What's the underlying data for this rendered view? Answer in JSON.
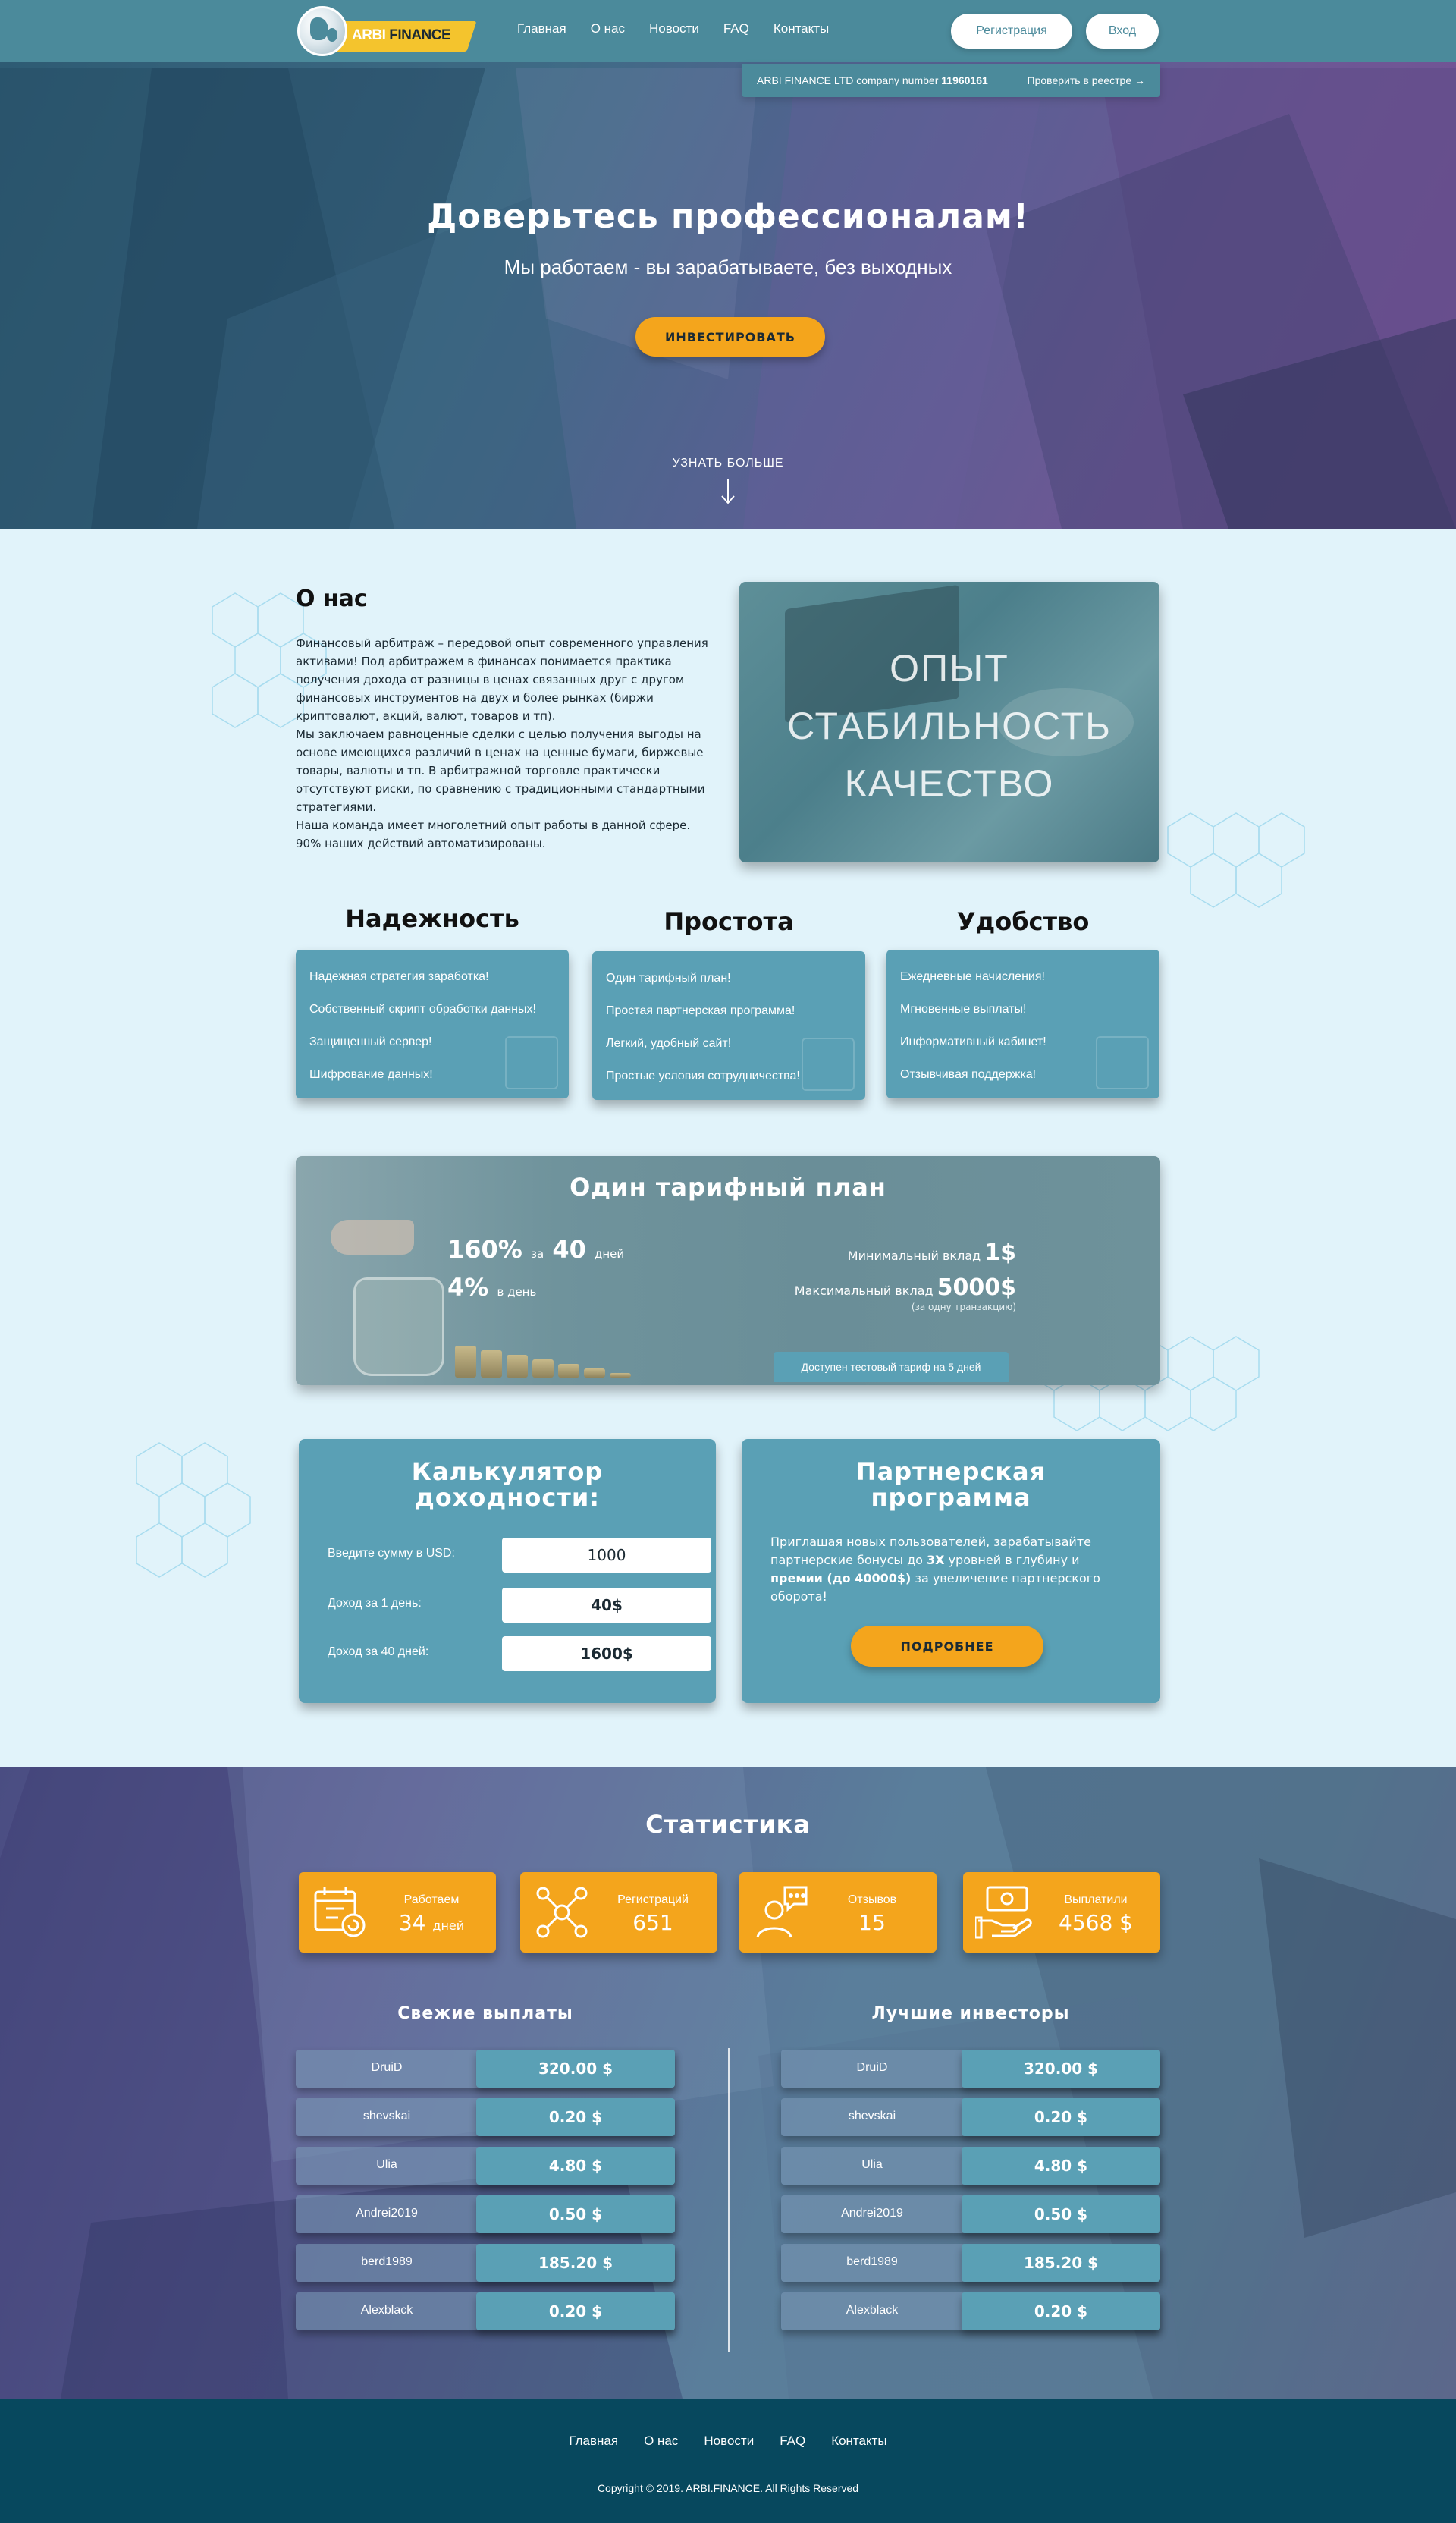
{
  "header": {
    "logo_part1": "ARBI",
    "logo_part2": "FINANCE",
    "nav": [
      "Главная",
      "О нас",
      "Новости",
      "FAQ",
      "Контакты"
    ],
    "register_label": "Регистрация",
    "login_label": "Вход"
  },
  "registry": {
    "company_text": "ARBI FINANCE LTD company number",
    "company_number": "11960161",
    "check_link": "Проверить в реестре →"
  },
  "hero": {
    "title": "Доверьтесь профессионалам!",
    "subtitle": "Мы работаем - вы зарабатываете, без выходных",
    "invest_label": "ИНВЕСТИРОВАТЬ",
    "learn_more": "УЗНАТЬ БОЛЬШЕ"
  },
  "about": {
    "title": "О нас",
    "paragraphs": [
      "Финансовый арбитраж – передовой опыт современного управления активами! Под арбитражем в финансах понимается практика получения дохода от разницы в ценах связанных друг с другом финансовых инструментов на двух и более рынках (биржи криптовалют, акций, валют, товаров и тп).",
      "Мы заключаем равноценные сделки с целью получения выгоды на основе имеющихся различий в ценах на ценные бумаги, биржевые товары, валюты и тп. В арбитражной торговле практически отсутствуют риски, по сравнению с традиционными стандартными стратегиями.",
      "Наша команда имеет многолетний опыт работы в данной сфере. 90% наших действий автоматизированы."
    ],
    "photo_words": [
      "ОПЫТ",
      "СТАБИЛЬНОСТЬ",
      "КАЧЕСТВО"
    ]
  },
  "features": [
    {
      "title": "Надежность",
      "items": [
        "Надежная стратегия заработка!",
        "Собственный скрипт обработки данных!",
        "Защищенный сервер!",
        "Шифрование данных!"
      ]
    },
    {
      "title": "Простота",
      "items": [
        "Один тарифный план!",
        "Простая партнерская программа!",
        "Легкий, удобный сайт!",
        "Простые условия сотрудничества!"
      ]
    },
    {
      "title": "Удобство",
      "items": [
        "Ежедневные начисления!",
        "Мгновенные выплаты!",
        "Информативный кабинет!",
        "Отзывчивая поддержка!"
      ]
    }
  ],
  "tariff": {
    "title": "Один тарифный план",
    "profit_pct": "160%",
    "profit_for": "за",
    "profit_days": "40",
    "profit_days_label": "дней",
    "daily_pct": "4%",
    "daily_label": "в день",
    "min_label": "Минимальный вклад",
    "min_value": "1$",
    "max_label": "Максимальный вклад",
    "max_value": "5000$",
    "max_note": "(за одну транзакцию)",
    "test_label": "Доступен тестовый тариф на 5 дней"
  },
  "calculator": {
    "title_line1": "Калькулятор",
    "title_line2": "доходности:",
    "amount_label": "Введите сумму в USD:",
    "amount_value": "1000",
    "day_label": "Доход за 1 день:",
    "day_value": "40$",
    "total_label": "Доход за 40 дней:",
    "total_value": "1600$"
  },
  "partner": {
    "title_line1": "Партнерская",
    "title_line2": "программа",
    "text_a": "Приглашая новых пользователей, зарабатывайте партнерские бонусы до ",
    "text_b": "3Х",
    "text_c": " уровней в глубину и ",
    "text_d": "премии (до 40000$)",
    "text_e": " за увеличение партнерского оборота!",
    "more_label": "ПОДРОБНЕЕ"
  },
  "stats": {
    "title": "Статистика",
    "cards": [
      {
        "label": "Работаем",
        "value": "34",
        "unit": "дней",
        "icon": "calendar-icon"
      },
      {
        "label": "Регистраций",
        "value": "651",
        "unit": "",
        "icon": "network-icon"
      },
      {
        "label": "Отзывов",
        "value": "15",
        "unit": "",
        "icon": "chat-user-icon"
      },
      {
        "label": "Выплатили",
        "value": "4568 $",
        "unit": "",
        "icon": "money-hand-icon"
      }
    ],
    "payouts_title": "Свежие выплаты",
    "investors_title": "Лучшие инвесторы",
    "payouts": [
      {
        "name": "DruiD",
        "amount": "320.00 $"
      },
      {
        "name": "shevskai",
        "amount": "0.20 $"
      },
      {
        "name": "Ulia",
        "amount": "4.80 $"
      },
      {
        "name": "Andrei2019",
        "amount": "0.50 $"
      },
      {
        "name": "berd1989",
        "amount": "185.20 $"
      },
      {
        "name": "Alexblack",
        "amount": "0.20 $"
      }
    ],
    "investors": [
      {
        "name": "DruiD",
        "amount": "320.00 $"
      },
      {
        "name": "shevskai",
        "amount": "0.20 $"
      },
      {
        "name": "Ulia",
        "amount": "4.80 $"
      },
      {
        "name": "Andrei2019",
        "amount": "0.50 $"
      },
      {
        "name": "berd1989",
        "amount": "185.20 $"
      },
      {
        "name": "Alexblack",
        "amount": "0.20 $"
      }
    ]
  },
  "footer": {
    "nav": [
      "Главная",
      "О нас",
      "Новости",
      "FAQ",
      "Контакты"
    ],
    "copyright": "Copyright © 2019. ARBI.FINANCE. All Rights Reserved"
  },
  "colors": {
    "header": "#4b8a9b",
    "card": "#5aa0b5",
    "accent": "#f4a51c",
    "footer": "#07485e",
    "page_bg": "#e1f3fa"
  }
}
